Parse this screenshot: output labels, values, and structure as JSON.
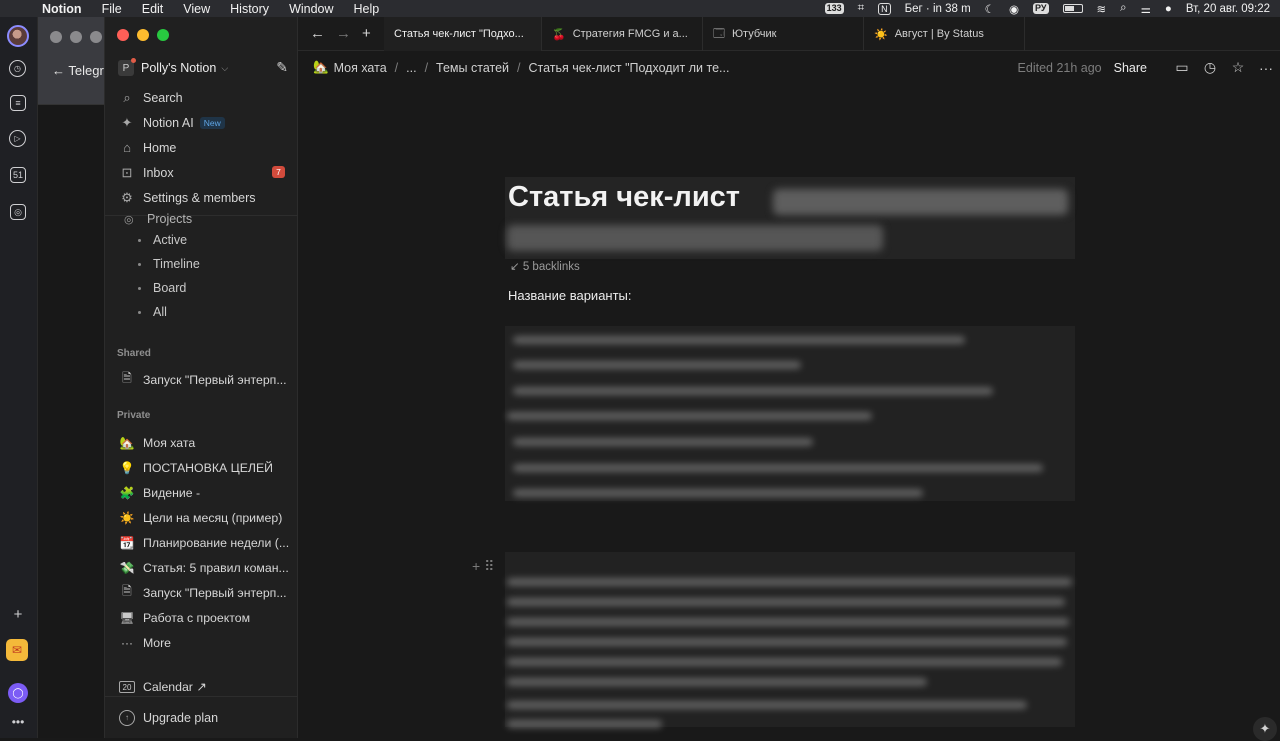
{
  "menubar": {
    "app": "Notion",
    "menus": [
      "File",
      "Edit",
      "View",
      "History",
      "Window",
      "Help"
    ],
    "status": {
      "badge_count": "133",
      "run_timer": "Бег · in 38 m",
      "lang": "РУ",
      "datetime": "Вт, 20 авг.  09:22"
    }
  },
  "telegram": {
    "back_label": "Telegr"
  },
  "rail": {
    "calendar_day": "51"
  },
  "workspace": {
    "name": "Polly's Notion",
    "icon_letter": "P"
  },
  "nav": {
    "search": "Search",
    "notion_ai": "Notion AI",
    "new_badge": "New",
    "home": "Home",
    "inbox": "Inbox",
    "inbox_count": "7",
    "settings": "Settings & members"
  },
  "tree": {
    "projects": "Projects",
    "views": [
      "Active",
      "Timeline",
      "Board",
      "All"
    ]
  },
  "shared": {
    "label": "Shared",
    "items": [
      {
        "icon": "page-icon",
        "emoji": "🗎",
        "title": "Запуск \"Первый энтерп..."
      }
    ]
  },
  "private": {
    "label": "Private",
    "items": [
      {
        "emoji": "🏡",
        "title": "Моя хата"
      },
      {
        "emoji": "💡",
        "title": "ПОСТАНОВКА ЦЕЛЕЙ"
      },
      {
        "emoji": "🧩",
        "title": "Видение -"
      },
      {
        "emoji": "☀️",
        "title": "Цели на месяц (пример)"
      },
      {
        "emoji": "📆",
        "title": "Планирование недели (..."
      },
      {
        "emoji": "💸",
        "title": "Статья: 5 правил коман..."
      },
      {
        "emoji": "🗎",
        "title": "Запуск \"Первый энтерп..."
      },
      {
        "emoji": "🖥",
        "title": "Работа с проектом"
      },
      {
        "emoji": "···",
        "title": "More"
      }
    ]
  },
  "calendar": {
    "label": "Calendar ↗",
    "day": "20"
  },
  "upgrade": "Upgrade plan",
  "tabs": [
    {
      "title": "Статья чек-лист \"Подхо...",
      "icon": ""
    },
    {
      "title": "Стратегия FMCG и а...",
      "icon": "🍒"
    },
    {
      "title": "Ютубчик",
      "icon": "🗔"
    },
    {
      "title": "Август | By Status",
      "icon": "☀️"
    }
  ],
  "breadcrumb": {
    "root": "Моя хата",
    "ellipsis": "...",
    "parent": "Темы статей",
    "current": "Статья чек-лист \"Подходит ли те..."
  },
  "topbar": {
    "edited": "Edited 21h ago",
    "share": "Share"
  },
  "page": {
    "title_visible": "Статья чек-лист",
    "backlinks": "5 backlinks",
    "label": "Название варианты:"
  },
  "colors": {
    "bg": "#191919",
    "sidebar": "#202020",
    "accent_red": "#d24b3c",
    "accent_blue": "#5fa6e6"
  }
}
